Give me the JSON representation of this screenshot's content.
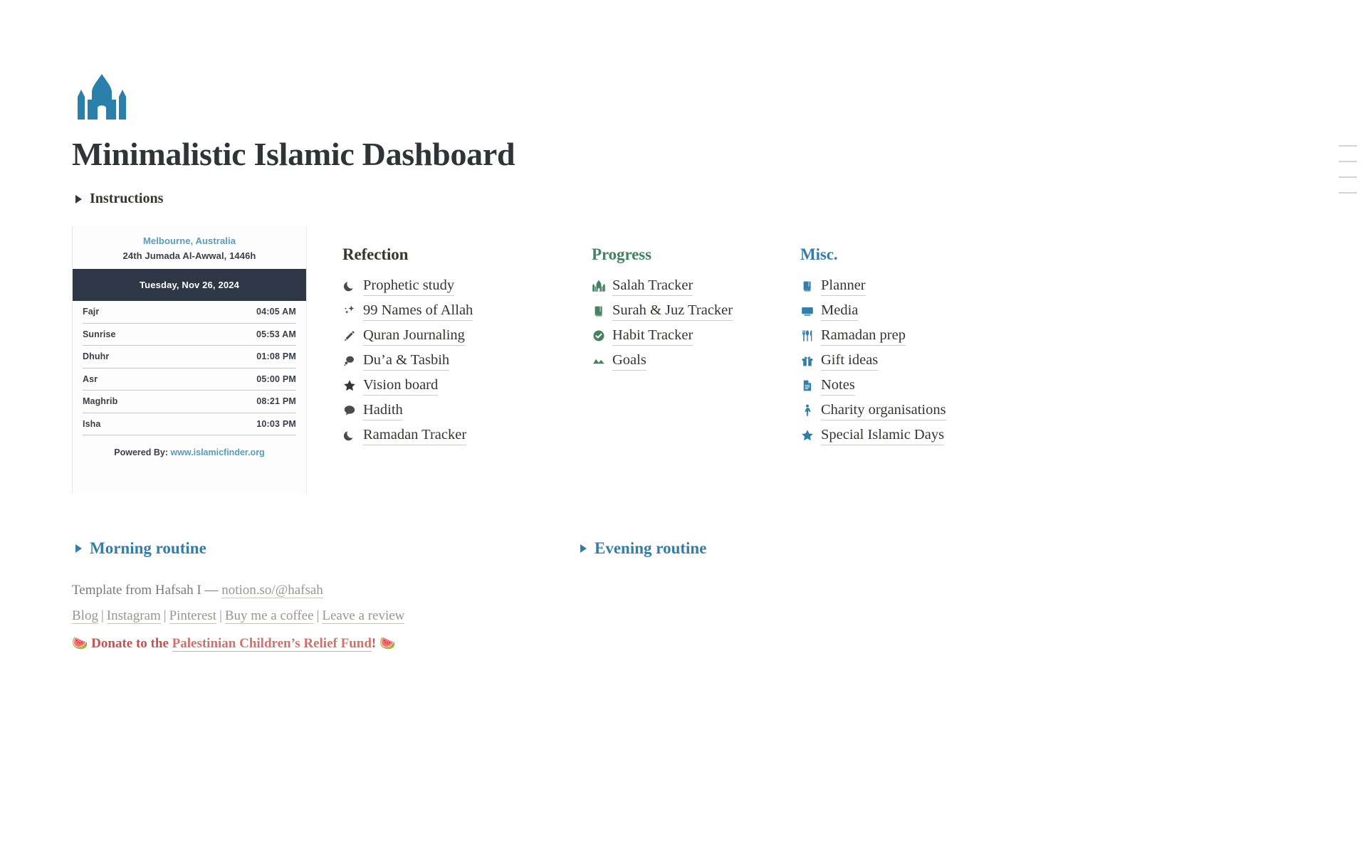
{
  "header": {
    "icon": "mosque-icon",
    "title": "Minimalistic Islamic Dashboard"
  },
  "toggles": {
    "instructions": "Instructions",
    "morning_routine": "Morning routine",
    "evening_routine": "Evening routine"
  },
  "prayer_widget": {
    "city": "Melbourne, Australia",
    "hijri_date": "24th Jumada Al-Awwal, 1446h",
    "gregorian_date": "Tuesday, Nov 26, 2024",
    "rows": [
      {
        "name": "Fajr",
        "time": "04:05 AM"
      },
      {
        "name": "Sunrise",
        "time": "05:53 AM"
      },
      {
        "name": "Dhuhr",
        "time": "01:08 PM"
      },
      {
        "name": "Asr",
        "time": "05:00 PM"
      },
      {
        "name": "Maghrib",
        "time": "08:21 PM"
      },
      {
        "name": "Isha",
        "time": "10:03 PM"
      }
    ],
    "powered_label": "Powered By:",
    "powered_link": "www.islamicfinder.org"
  },
  "columns": [
    {
      "id": "refection",
      "heading": "Refection",
      "accent": "#37352f",
      "items": [
        {
          "label": "Prophetic study",
          "icon": "crescent-moon-icon"
        },
        {
          "label": "99 Names of Allah",
          "icon": "sparkles-icon"
        },
        {
          "label": "Quran Journaling",
          "icon": "pencil-icon"
        },
        {
          "label": "Du’a & Tasbih",
          "icon": "thought-bubble-icon"
        },
        {
          "label": "Vision board",
          "icon": "star-icon"
        },
        {
          "label": "Hadith",
          "icon": "speech-bubble-icon"
        },
        {
          "label": "Ramadan Tracker",
          "icon": "crescent-moon-icon"
        }
      ]
    },
    {
      "id": "progress",
      "heading": "Progress",
      "accent": "#448361",
      "items": [
        {
          "label": "Salah Tracker",
          "icon": "mosque-icon"
        },
        {
          "label": "Surah & Juz Tracker",
          "icon": "books-icon"
        },
        {
          "label": "Habit Tracker",
          "icon": "check-circle-icon"
        },
        {
          "label": "Goals",
          "icon": "mountains-icon"
        }
      ]
    },
    {
      "id": "misc",
      "heading": "Misc.",
      "accent": "#337ea9",
      "items": [
        {
          "label": "Planner",
          "icon": "books-icon"
        },
        {
          "label": "Media",
          "icon": "monitor-icon"
        },
        {
          "label": "Ramadan prep",
          "icon": "utensils-icon"
        },
        {
          "label": "Gift ideas",
          "icon": "gift-icon"
        },
        {
          "label": "Notes",
          "icon": "document-icon"
        },
        {
          "label": "Charity organisations",
          "icon": "person-icon"
        },
        {
          "label": "Special Islamic Days",
          "icon": "star-icon"
        }
      ]
    }
  ],
  "footer": {
    "credit_text": "Template from Hafsah I — ",
    "credit_link": "notion.so/@hafsah",
    "links": [
      "Blog",
      "Instagram",
      "Pinterest",
      "Buy me a coffee",
      "Leave a review"
    ],
    "separator": "|",
    "donate_prefix": "Donate to the ",
    "donate_link": "Palestinian Children’s Relief Fund",
    "donate_suffix": "!",
    "donate_emoji": "🍉"
  },
  "colors": {
    "blue": "#337ea9",
    "green": "#448361",
    "navy": "#2f3747",
    "red": "#d44c47"
  }
}
